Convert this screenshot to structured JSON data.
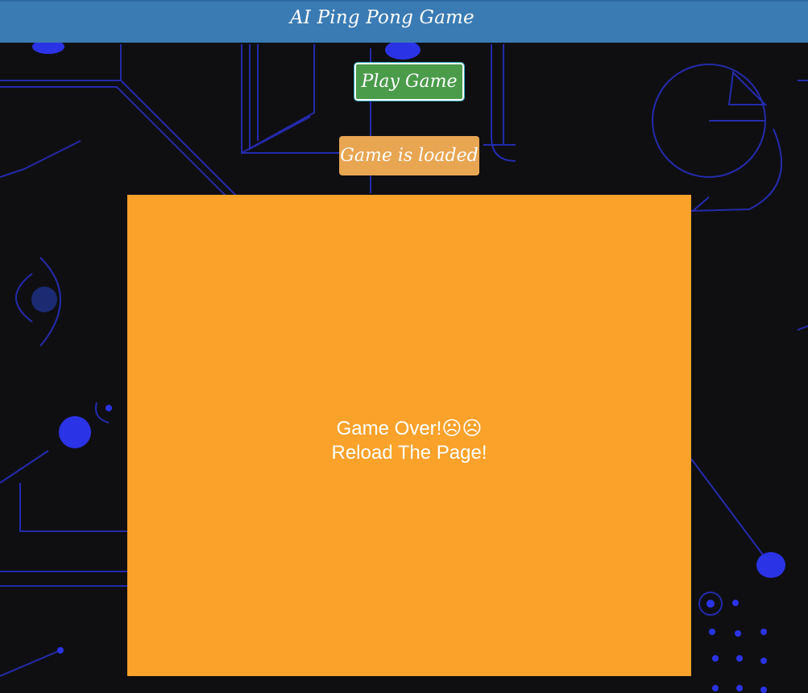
{
  "header": {
    "title": "AI Ping Pong Game"
  },
  "controls": {
    "play_label": "Play Game",
    "status_label": "Game is loaded"
  },
  "game": {
    "line1": "Game Over!☹☹",
    "line2": "Reload The Page!"
  },
  "colors": {
    "header_bg": "#3a7bb4",
    "play_button_bg": "#4a9b4a",
    "status_button_bg": "#e8a552",
    "board_bg": "#fba22b",
    "page_bg": "#0f0f11",
    "art_stroke": "#2a2fd0"
  }
}
